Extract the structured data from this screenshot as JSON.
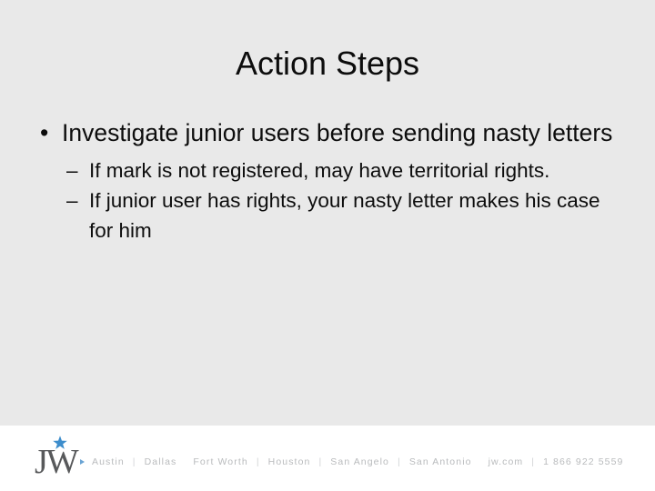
{
  "slide": {
    "title": "Action Steps",
    "background_color": "#e9e9e9",
    "footer_background_color": "#ffffff",
    "text_color": "#0d0d0d",
    "bullets": [
      {
        "marker": "•",
        "text": "Investigate junior users before sending nasty letters",
        "sub_bullets": [
          {
            "marker": "–",
            "text": "If mark is not registered, may have territorial rights."
          },
          {
            "marker": "–",
            "text": "If junior user has rights, your nasty letter makes his case for him"
          }
        ]
      }
    ]
  },
  "footer": {
    "logo": {
      "monogram": "JW",
      "star_color": "#3d8dcc",
      "monogram_color": "#58595b"
    },
    "marker": "▸",
    "offices": [
      "Austin",
      "Dallas",
      "Fort Worth",
      "Houston",
      "San Angelo",
      "San Antonio"
    ],
    "separator": "|",
    "website": "jw.com",
    "phone": "1 866 922 5559",
    "text_color": "#b9bbbd"
  }
}
